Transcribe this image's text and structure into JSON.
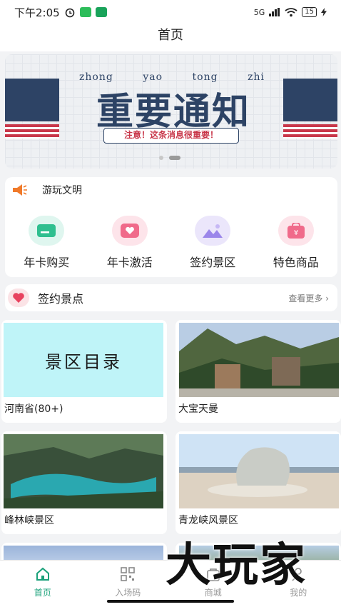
{
  "statusbar": {
    "time": "下午2:05",
    "network": "5G",
    "battery": "15"
  },
  "header": {
    "title": "首页"
  },
  "banner": {
    "pinyin": [
      "zhong",
      "yao",
      "tong",
      "zhi"
    ],
    "title": "重要通知",
    "notice": "注意！这条消息很重要！",
    "colors": {
      "navy": "#2d4365",
      "red": "#c8374a"
    }
  },
  "announcement": {
    "text": "游玩文明"
  },
  "menu": [
    {
      "label": "年卡购买",
      "icon": "card-icon",
      "color": "#dff6ef",
      "accent": "#2fbf8f"
    },
    {
      "label": "年卡激活",
      "icon": "heart-card-icon",
      "color": "#fde4ea",
      "accent": "#f06a8a"
    },
    {
      "label": "签约景区",
      "icon": "landscape-icon",
      "color": "#ebe6fb",
      "accent": "#9b86ea"
    },
    {
      "label": "特色商品",
      "icon": "shopping-bag-icon",
      "color": "#fde4ea",
      "accent": "#f06a8a"
    }
  ],
  "section": {
    "title": "签约景点",
    "more": "查看更多"
  },
  "scenic_spots": [
    {
      "name": "河南省(80+)",
      "thumb_text": "景区目录",
      "thumb_bg": "#bff4f8"
    },
    {
      "name": "大宝天曼",
      "thumb_text": "",
      "thumb_bg": ""
    },
    {
      "name": "峰林峡景区",
      "thumb_text": "",
      "thumb_bg": ""
    },
    {
      "name": "青龙峡风景区",
      "thumb_text": "",
      "thumb_bg": ""
    }
  ],
  "tabbar": [
    {
      "label": "首页",
      "icon": "home-icon",
      "active": true
    },
    {
      "label": "入场码",
      "icon": "qr-code-icon",
      "active": false
    },
    {
      "label": "商城",
      "icon": "store-icon",
      "active": false
    },
    {
      "label": "我的",
      "icon": "user-icon",
      "active": false
    }
  ],
  "watermark": "大玩家",
  "accent_color": "#1aa17a"
}
